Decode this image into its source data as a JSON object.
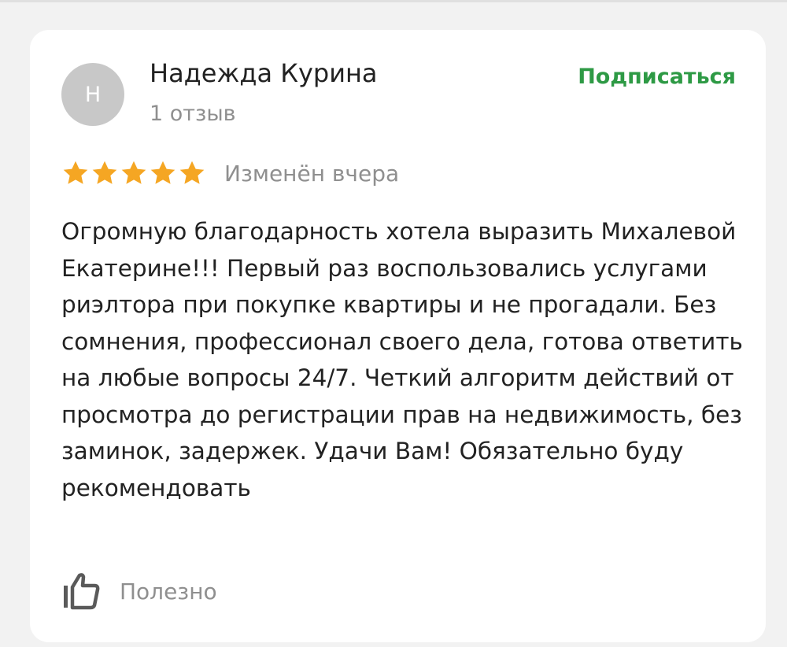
{
  "review": {
    "avatar_initial": "Н",
    "author_name": "Надежда Курина",
    "review_count": "1 отзыв",
    "subscribe_label": "Подписаться",
    "rating": 5,
    "rating_max": 5,
    "modified": "Изменён вчера",
    "text": "Огромную благодарность хотела выразить Михалевой Екатерине!!! Первый раз воспользовались услугами риэлтора при покупке квартиры и не прогадали. Без сомнения, профессионал своего дела, готова ответить на любые вопросы 24/7. Четкий алгоритм действий от просмотра до регистрации прав на недвижимость, без заминок, задержек. Удачи Вам! Обязательно буду рекомендовать",
    "helpful_label": "Полезно"
  },
  "icons": {
    "star": "star-icon",
    "helpful": "thumbs-up-icon"
  },
  "colors": {
    "background": "#f2f2f2",
    "card": "#ffffff",
    "accent": "#2e9a45",
    "star": "#f5a623",
    "avatar": "#c8c8c8",
    "muted_text": "#8f8f8f",
    "text": "#222222"
  }
}
